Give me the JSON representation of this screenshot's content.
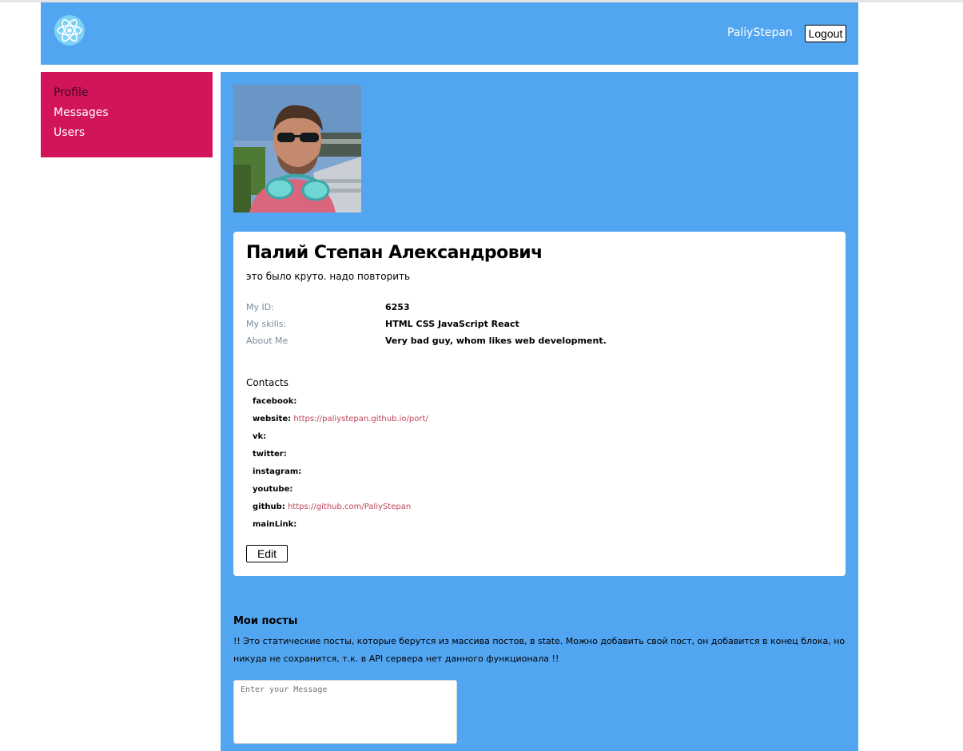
{
  "header": {
    "username": "PaliyStepan",
    "logout_label": "Logout"
  },
  "icons": {
    "logo": "react-atom-icon"
  },
  "colors": {
    "accent_blue": "#52a5f0",
    "sidebar_pink": "#d2145a",
    "link": "#c0455a"
  },
  "sidebar": {
    "items": [
      {
        "label": "Profile",
        "active": true
      },
      {
        "label": "Messages",
        "active": false
      },
      {
        "label": "Users",
        "active": false
      }
    ]
  },
  "profile": {
    "full_name": "Палий Степан Александрович",
    "status": "это было круто. надо повторить",
    "info": [
      {
        "label": "My ID:",
        "value": "6253"
      },
      {
        "label": "My skills:",
        "value": "HTML CSS JavaScript React"
      },
      {
        "label": "About Me",
        "value": "Very bad guy, whom likes web development."
      }
    ],
    "contacts_title": "Contacts",
    "contacts": [
      {
        "key": "facebook:",
        "value": ""
      },
      {
        "key": "website:",
        "value": "https://paliystepan.github.io/port/"
      },
      {
        "key": "vk:",
        "value": ""
      },
      {
        "key": "twitter:",
        "value": ""
      },
      {
        "key": "instagram:",
        "value": ""
      },
      {
        "key": "youtube:",
        "value": ""
      },
      {
        "key": "github:",
        "value": "https://github.com/PaliyStepan"
      },
      {
        "key": "mainLink:",
        "value": ""
      }
    ],
    "edit_label": "Edit"
  },
  "posts": {
    "title": "Мои посты",
    "note": "!! Это статические посты, которые берутся из массива постов, в state. Можно добавить свой пост, он добавится в конец блока, но никуда не сохранится, т.к. в API сервера нет данного функционала !!",
    "input_placeholder": "Enter your Message"
  }
}
